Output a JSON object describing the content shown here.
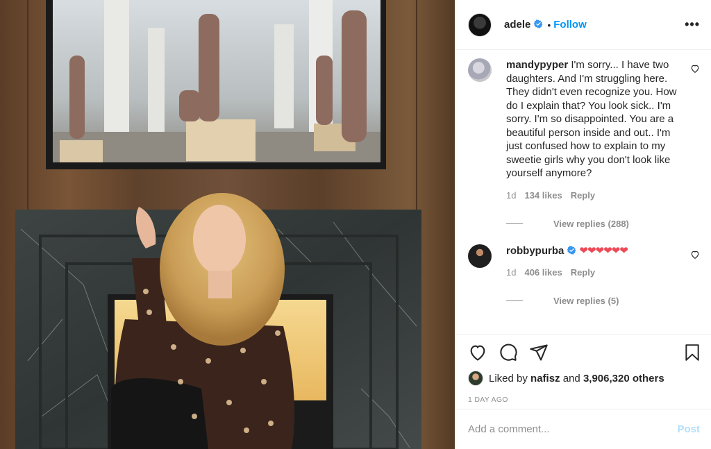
{
  "header": {
    "username": "adele",
    "separator": "•",
    "follow_label": "Follow",
    "more_label": "•••"
  },
  "comments": [
    {
      "username": "mandypyper",
      "text": "I'm sorry... I have two daughters. And I'm struggling here. They didn't even recognize you. How do I explain that? You look sick.. I'm sorry. I'm so disappointed. You are a beautiful person inside and out.. I'm just confused how to explain to my sweetie girls why you don't look like yourself anymore?",
      "age": "1d",
      "likes": "134 likes",
      "reply_label": "Reply",
      "view_replies": "View replies (288)"
    },
    {
      "username": "robbypurba",
      "text": "❤❤❤❤❤❤",
      "age": "1d",
      "likes": "406 likes",
      "reply_label": "Reply",
      "view_replies": "View replies (5)"
    }
  ],
  "likes": {
    "prefix": "Liked by",
    "user": "nafisz",
    "conj": "and",
    "others": "3,906,320 others"
  },
  "timestamp": "1 DAY AGO",
  "add_comment": {
    "placeholder": "Add a comment...",
    "post_label": "Post"
  },
  "colors": {
    "accent": "#0095f6",
    "post_disabled": "#b2dffc",
    "meta_gray": "#8e8e8e",
    "heart_red": "#ed4956"
  },
  "icons": [
    "verified-icon",
    "more-icon",
    "heart-icon",
    "comment-icon",
    "share-icon",
    "bookmark-icon"
  ]
}
